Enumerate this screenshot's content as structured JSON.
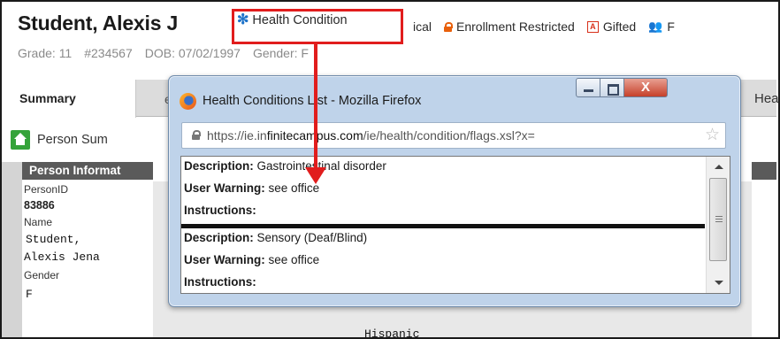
{
  "header": {
    "student_name": "Student, Alexis J",
    "health_flag_label": "Health Condition",
    "flags": [
      {
        "label": "ical",
        "icon": "none"
      },
      {
        "label": "Enrollment Restricted",
        "icon": "lock-icon"
      },
      {
        "label": "Gifted",
        "icon": "gifted-icon"
      },
      {
        "label": "F",
        "icon": "people-icon"
      }
    ],
    "meta": {
      "grade": "Grade: 11",
      "student_number": "#234567",
      "dob": "DOB: 07/02/1997",
      "gender": "Gender: F"
    }
  },
  "tabs": {
    "active": "Summary",
    "partial_left": "er",
    "partial_right": "Hea"
  },
  "left_panel": {
    "person_summary_label": "Person Sum",
    "section_title": "Person Informat",
    "person_id_label": "PersonID",
    "person_id_value": "83886",
    "name_label": "Name",
    "name_line1": "Student,",
    "name_line2": "Alexis Jena",
    "gender_label": "Gender",
    "gender_value": "F",
    "ethnicity_value": "Hispanic"
  },
  "popup": {
    "title": "Health Conditions List - Mozilla Firefox",
    "url_prefix": "https://ie.in",
    "url_host_mid": "finitecampus.com",
    "url_path": "/ie/health/condition/flags.xsl?x=",
    "close_glyph": "X",
    "entries": [
      {
        "description_label": "Description:",
        "description_value": "Gastrointestinal disorder",
        "warning_label": "User Warning:",
        "warning_value": "see office",
        "instructions_label": "Instructions:"
      },
      {
        "description_label": "Description:",
        "description_value": "Sensory (Deaf/Blind)",
        "warning_label": "User Warning:",
        "warning_value": "see office",
        "instructions_label": "Instructions:"
      }
    ]
  },
  "colors": {
    "annotation_red": "#e11d1d",
    "health_icon_blue": "#1e73c9",
    "restricted_orange": "#e8600b",
    "home_green": "#35a33a",
    "section_header_gray": "#5a5a5a"
  }
}
